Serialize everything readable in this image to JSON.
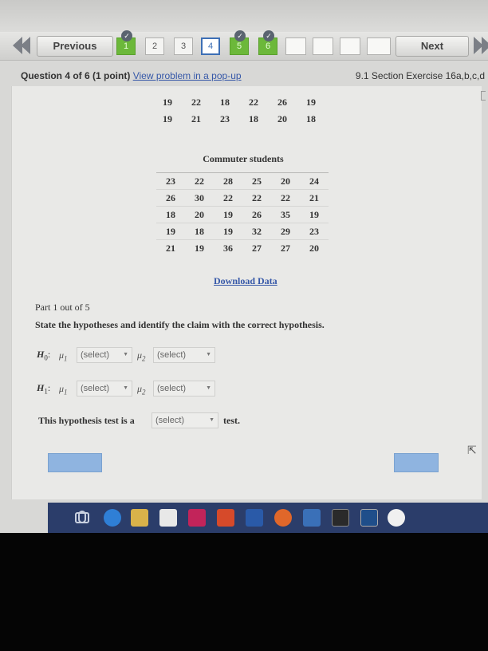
{
  "nav": {
    "previous_label": "Previous",
    "next_label": "Next",
    "questions": [
      {
        "label": "1",
        "state": "done"
      },
      {
        "label": "2",
        "state": "normal"
      },
      {
        "label": "3",
        "state": "normal"
      },
      {
        "label": "4",
        "state": "current"
      },
      {
        "label": "5",
        "state": "done"
      },
      {
        "label": "6",
        "state": "done"
      },
      {
        "label": "",
        "state": "empty"
      },
      {
        "label": "",
        "state": "empty"
      },
      {
        "label": "",
        "state": "empty"
      },
      {
        "label": "",
        "state": "empty"
      },
      {
        "label": "",
        "state": "empty"
      }
    ]
  },
  "header": {
    "question_label": "Question 4 of 6 (1 point)",
    "popup_link": "View problem in a pop-up",
    "section_label": "9.1 Section Exercise 16a,b,c,d"
  },
  "top_table": [
    [
      "19",
      "22",
      "18",
      "22",
      "26",
      "19"
    ],
    [
      "19",
      "21",
      "23",
      "18",
      "20",
      "18"
    ]
  ],
  "commuter": {
    "title": "Commuter students",
    "rows": [
      [
        "23",
        "22",
        "28",
        "25",
        "20",
        "24"
      ],
      [
        "26",
        "30",
        "22",
        "22",
        "22",
        "21"
      ],
      [
        "18",
        "20",
        "19",
        "26",
        "35",
        "19"
      ],
      [
        "19",
        "18",
        "19",
        "32",
        "29",
        "23"
      ],
      [
        "21",
        "19",
        "36",
        "27",
        "27",
        "20"
      ]
    ]
  },
  "download_label": "Download Data",
  "part": {
    "label": "Part 1 out of 5",
    "instruction": "State the hypotheses and identify the claim with the correct hypothesis."
  },
  "hypotheses": {
    "h0_label": "H",
    "h0_sub": "0",
    "h1_label": "H",
    "h1_sub": "1",
    "mu1": "μ",
    "mu1_sub": "1",
    "mu2": "μ",
    "mu2_sub": "2",
    "select_placeholder": "(select)"
  },
  "test_line": {
    "prefix": "This hypothesis test is a",
    "select_placeholder": "(select)",
    "suffix": "test."
  },
  "colors": {
    "accent_blue": "#3658a8",
    "done_green": "#6cb83a",
    "button_blue": "#8fb4e0",
    "taskbar": "#2b3d6a"
  }
}
